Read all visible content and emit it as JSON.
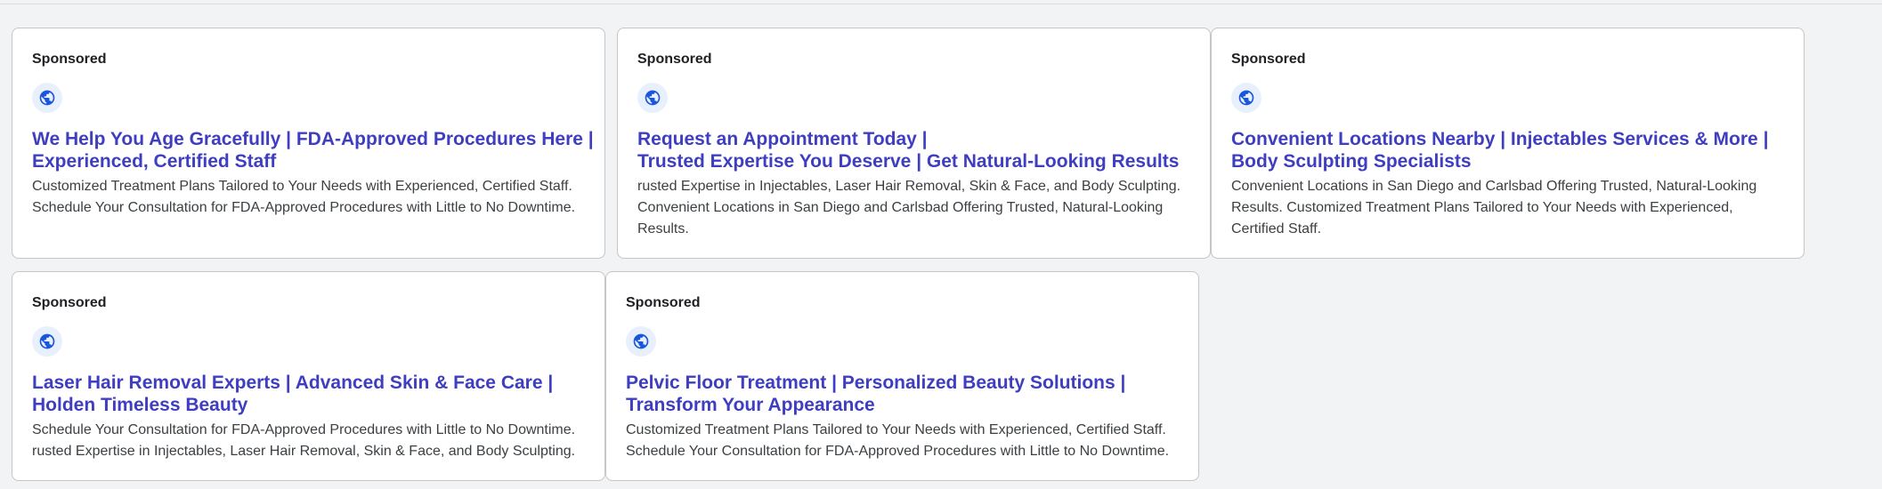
{
  "ads": [
    {
      "sponsored_label": "Sponsored",
      "icon": "globe-icon",
      "title_lines": [
        "We Help You Age Gracefully | FDA-Approved Procedures Here |",
        "Experienced, Certified Staff"
      ],
      "description_lines": [
        "Customized Treatment Plans Tailored to Your Needs with Experienced, Certified Staff.",
        "Schedule Your Consultation for FDA-Approved Procedures with Little to No Downtime."
      ]
    },
    {
      "sponsored_label": "Sponsored",
      "icon": "globe-icon",
      "title_lines": [
        "Request an Appointment Today |",
        "Trusted Expertise You Deserve | Get Natural-Looking Results"
      ],
      "description_lines": [
        "rusted Expertise in Injectables, Laser Hair Removal, Skin & Face, and Body Sculpting.",
        "Convenient Locations in San Diego and Carlsbad Offering Trusted, Natural-Looking",
        "Results."
      ]
    },
    {
      "sponsored_label": "Sponsored",
      "icon": "globe-icon",
      "title_lines": [
        "Convenient Locations Nearby | Injectables Services & More |",
        "Body Sculpting Specialists"
      ],
      "description_lines": [
        "Convenient Locations in San Diego and Carlsbad Offering Trusted, Natural-Looking",
        "Results. Customized Treatment Plans Tailored to Your Needs with Experienced,",
        "Certified Staff."
      ]
    },
    {
      "sponsored_label": "Sponsored",
      "icon": "globe-icon",
      "title_lines": [
        "Laser Hair Removal Experts | Advanced Skin & Face Care |",
        "Holden Timeless Beauty"
      ],
      "description_lines": [
        "Schedule Your Consultation for FDA-Approved Procedures with Little to No Downtime.",
        "rusted Expertise in Injectables, Laser Hair Removal, Skin & Face, and Body Sculpting."
      ]
    },
    {
      "sponsored_label": "Sponsored",
      "icon": "globe-icon",
      "title_lines": [
        "Pelvic Floor Treatment | Personalized Beauty Solutions |",
        "Transform Your Appearance"
      ],
      "description_lines": [
        "Customized Treatment Plans Tailored to Your Needs with Experienced, Certified Staff.",
        "Schedule Your Consultation for FDA-Approved Procedures with Little to No Downtime."
      ]
    }
  ],
  "colors": {
    "page_background": "#f1f3f4",
    "card_border": "#c4c7c5",
    "title_link": "#3f3ec1",
    "body_text": "#3c4043",
    "globe_badge_bg": "#e8f0fe",
    "globe_icon": "#1a56db"
  }
}
